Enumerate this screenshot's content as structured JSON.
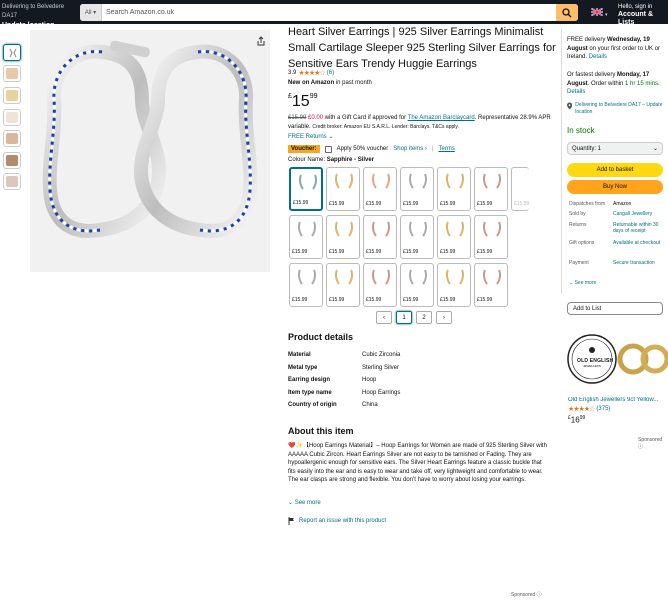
{
  "nav": {
    "deliver_line1": "Delivering to Belvedere DA17",
    "deliver_line2": "Update location",
    "search_category": "All",
    "search_placeholder": "Search Amazon.co.uk",
    "account_line1": "Hello, sign in",
    "account_line2": "Account & Lists"
  },
  "product": {
    "title": "Heart Silver Earrings | 925 Silver Earrings Minimalist Small Cartilage Sleeper 925 Sterling Silver Earrings for Sensitive Ears Trendy Huggie Earrings",
    "rating_value": "3.9",
    "rating_stars": "★★★★☆",
    "rating_count": "(6)",
    "new_on": "New on Amazon",
    "new_on_suffix": "in past month",
    "price_symbol": "£",
    "price_whole": "15",
    "price_fraction": "99",
    "promo_old": "£15.99",
    "promo_new": "£0.00",
    "promo_text": "with a Gift Card if approved for",
    "promo_link": "The Amazon Barclaycard",
    "promo_rest": ". Representative 28.9% APR variable.",
    "promo_small": "Credit broker: Amazon EU S.A.R.L. Lender: Barclays. T&Cs apply.",
    "free_returns": "FREE Returns",
    "voucher_badge": "Voucher:",
    "voucher_text": "Apply 50% voucher",
    "voucher_shop": "Shop items ›",
    "voucher_terms": "Terms",
    "colour_label": "Colour Name:",
    "colour_value": "Sapphire - Silver",
    "swatch_price": "£15.99",
    "page_current": "1",
    "page_next": "2"
  },
  "details": {
    "heading": "Product details",
    "rows": [
      {
        "k": "Material",
        "v": "Cubic Zirconia"
      },
      {
        "k": "Metal type",
        "v": "Sterling Silver"
      },
      {
        "k": "Earring design",
        "v": "Hoop"
      },
      {
        "k": "Item type name",
        "v": "Hoop Earrings"
      },
      {
        "k": "Country of origin",
        "v": "China"
      }
    ]
  },
  "about": {
    "heading": "About this item",
    "text": "❤️✨【Hoop Earrings Material】– Hoop Earrings for Women are made of 925 Sterling Silver with AAAAA Cubic Zircon. Heart Earrings Silver are not easy to be tarnished or Fading. They are hypoallergenic enough for sensitive ears. The Silver Heart Earrings feature a classic buckle that fits easily into the ear and is easy to wear and take off, very lightweight and comfortable to wear. The ear clasps are strong and flexible. You don't have to worry about losing your earrings.",
    "see_more": "See more",
    "report": "Report an issue with this product"
  },
  "buybox": {
    "delivery": "FREE delivery",
    "delivery_date": "Wednesday, 19 August",
    "delivery_rest": "on your first order to UK or Ireland.",
    "details_link": "Details",
    "fast_prefix": "Or fastest delivery",
    "fast_date": "Monday, 17 August",
    "fast_mid": ". Order within",
    "fast_time": "1 hr 15 mins",
    "location": "Delivering to Belvedere DA17 – Update location",
    "in_stock": "In stock",
    "quantity": "Quantity: 1",
    "add_to_basket": "Add to basket",
    "buy_now": "Buy Now",
    "info": [
      {
        "k": "Dispatches from",
        "v": "Amazon"
      },
      {
        "k": "Sold by",
        "v": "Cangall Jewellery"
      },
      {
        "k": "Returns",
        "v": "Returnable within 30 days of receipt"
      },
      {
        "k": "Gift options",
        "v": "Available at checkout"
      },
      {
        "k": "Payment",
        "v": "Secure transaction"
      }
    ],
    "see_more": "See more",
    "add_to_list": "Add to List"
  },
  "ad": {
    "brand": "OLD ENGLISH",
    "brand_sub": "JEWELLERS",
    "title": "Old English Jewellers 9ct Yellow...",
    "stars": "★★★★☆",
    "count": "(375)",
    "price_symbol": "£",
    "price_whole": "16",
    "price_fraction": "99",
    "sponsored": "Sponsored"
  },
  "footer": {
    "sponsored": "Sponsored"
  },
  "colors": {
    "nav": "#131921",
    "search_button": "#febd69",
    "basket": "#ffd814",
    "buy_now": "#ffa41c",
    "link": "#007185",
    "in_stock": "#007600",
    "sapphire": "#1a3fa8"
  }
}
